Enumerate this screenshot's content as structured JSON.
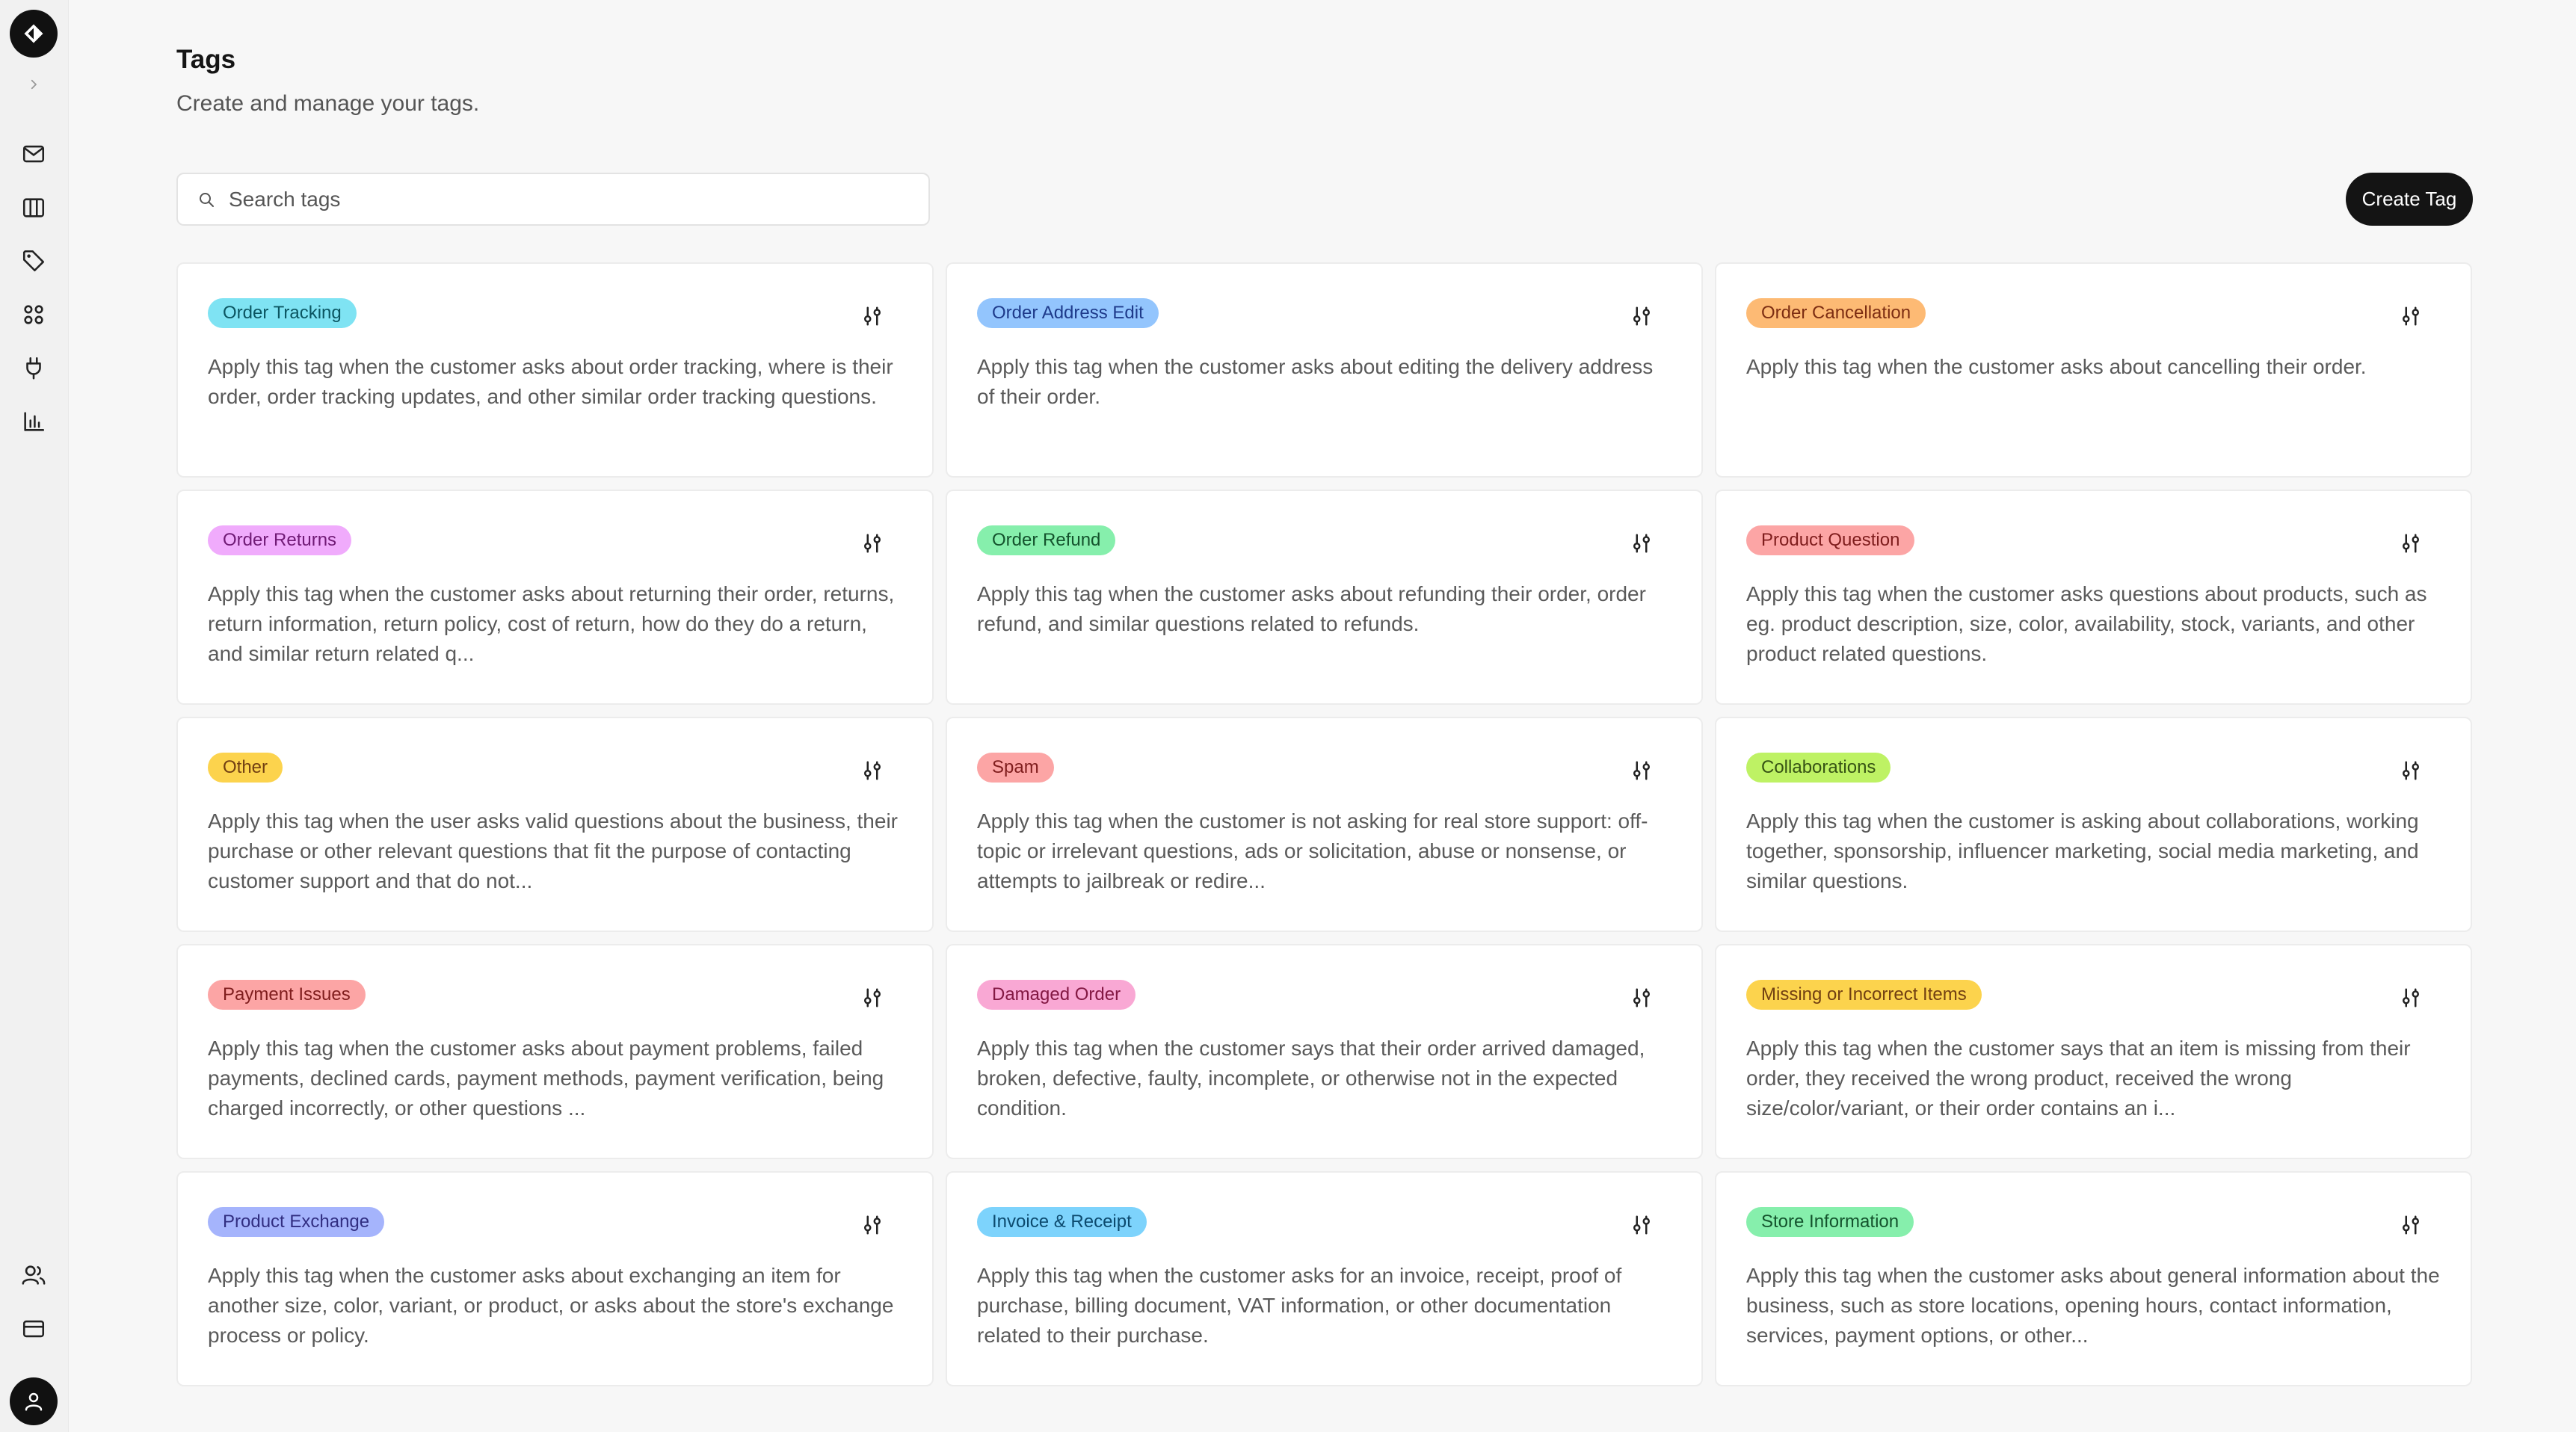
{
  "header": {
    "title": "Tags",
    "subtitle": "Create and manage your tags."
  },
  "search": {
    "placeholder": "Search tags",
    "value": ""
  },
  "actions": {
    "create_label": "Create Tag"
  },
  "sidebar": {
    "items": [
      {
        "icon": "mail-icon"
      },
      {
        "icon": "columns-icon"
      },
      {
        "icon": "tag-icon"
      },
      {
        "icon": "grid-icon"
      },
      {
        "icon": "plug-icon"
      },
      {
        "icon": "bar-chart-icon"
      }
    ],
    "bottom_items": [
      {
        "icon": "users-icon"
      },
      {
        "icon": "card-icon"
      }
    ]
  },
  "tags": [
    {
      "name": "Order Tracking",
      "bg": "#7fe3f3",
      "fg": "#0b5561",
      "description": "Apply this tag when the customer asks about order tracking, where is their order, order tracking updates, and other similar order tracking questions."
    },
    {
      "name": "Order Address Edit",
      "bg": "#93c5fd",
      "fg": "#1e3a8a",
      "description": "Apply this tag when the customer asks about editing the delivery address of their order."
    },
    {
      "name": "Order Cancellation",
      "bg": "#fdba74",
      "fg": "#7c2d12",
      "description": "Apply this tag when the customer asks about cancelling their order."
    },
    {
      "name": "Order Returns",
      "bg": "#f0abfc",
      "fg": "#701a75",
      "description": "Apply this tag when the customer asks about returning their order, returns, return information, return policy, cost of return, how do they do a return, and similar return related q..."
    },
    {
      "name": "Order Refund",
      "bg": "#86efac",
      "fg": "#14532d",
      "description": "Apply this tag when the customer asks about refunding their order, order refund, and similar questions related to refunds."
    },
    {
      "name": "Product Question",
      "bg": "#fca5a5",
      "fg": "#7f1d1d",
      "description": "Apply this tag when the customer asks questions about products, such as eg. product description, size, color, availability, stock, variants, and other product related questions."
    },
    {
      "name": "Other",
      "bg": "#fcd34d",
      "fg": "#713f12",
      "description": "Apply this tag when the user asks valid questions about the business, their purchase or other relevant questions that fit the purpose of contacting customer support and that do not..."
    },
    {
      "name": "Spam",
      "bg": "#fca5a5",
      "fg": "#7f1d1d",
      "description": "Apply this tag when the customer is not asking for real store support: off-topic or irrelevant questions, ads or solicitation, abuse or nonsense, or attempts to jailbreak or redire..."
    },
    {
      "name": "Collaborations",
      "bg": "#bef264",
      "fg": "#365314",
      "description": "Apply this tag when the customer is asking about collaborations, working together, sponsorship, influencer marketing, social media marketing, and similar questions."
    },
    {
      "name": "Payment Issues",
      "bg": "#fca5a5",
      "fg": "#7f1d1d",
      "description": "Apply this tag when the customer asks about payment problems, failed payments, declined cards, payment methods, payment verification, being charged incorrectly, or other questions ..."
    },
    {
      "name": "Damaged Order",
      "bg": "#f9a8d4",
      "fg": "#831843",
      "description": "Apply this tag when the customer says that their order arrived damaged, broken, defective, faulty, incomplete, or otherwise not in the expected condition."
    },
    {
      "name": "Missing or Incorrect Items",
      "bg": "#fcd34d",
      "fg": "#713f12",
      "description": "Apply this tag when the customer says that an item is missing from their order, they received the wrong product, received the wrong size/color/variant, or their order contains an i..."
    },
    {
      "name": "Product Exchange",
      "bg": "#a5b4fc",
      "fg": "#312e81",
      "description": "Apply this tag when the customer asks about exchanging an item for another size, color, variant, or product, or asks about the store's exchange process or policy."
    },
    {
      "name": "Invoice & Receipt",
      "bg": "#7dd3fc",
      "fg": "#0c4a6e",
      "description": "Apply this tag when the customer asks for an invoice, receipt, proof of purchase, billing document, VAT information, or other documentation related to their purchase."
    },
    {
      "name": "Store Information",
      "bg": "#86efac",
      "fg": "#14532d",
      "description": "Apply this tag when the customer asks about general information about the business, such as store locations, opening hours, contact information, services, payment options, or other..."
    }
  ]
}
